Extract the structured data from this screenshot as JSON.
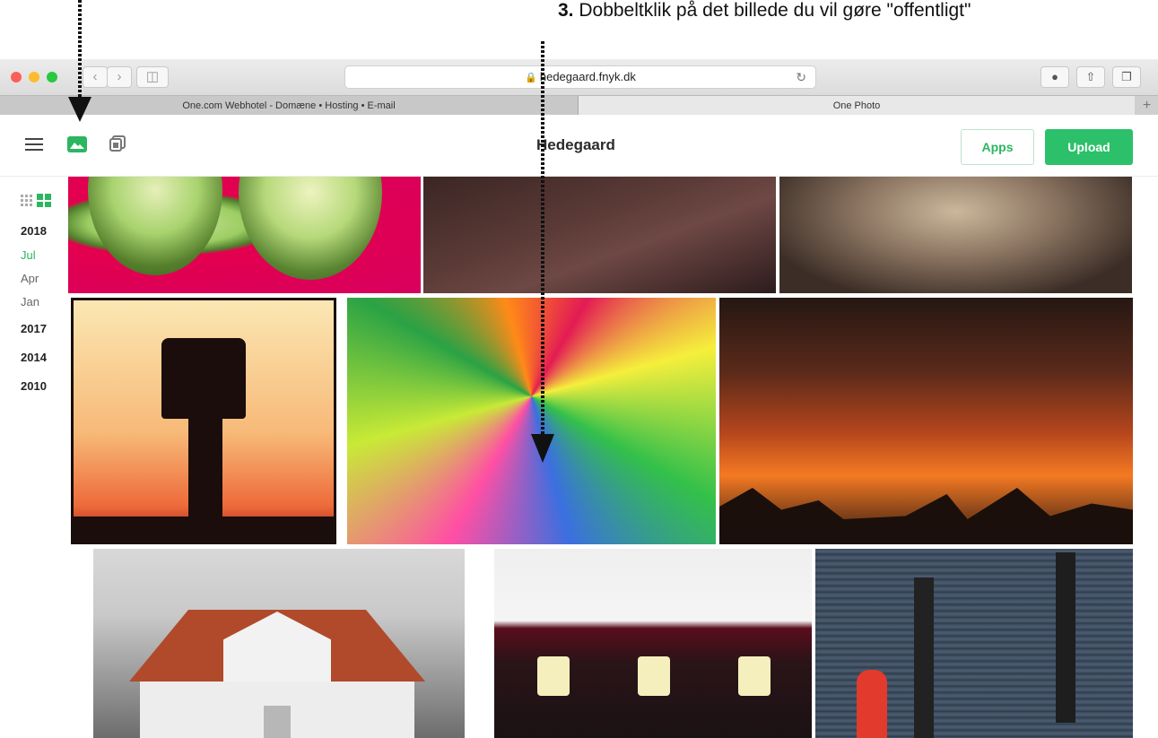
{
  "instruction": {
    "number": "3.",
    "text": " Dobbeltklik på det billede du vil gøre \"offentligt\""
  },
  "browser": {
    "url": "hedegaard.fnyk.dk",
    "tabs": [
      {
        "label": "One.com Webhotel  -  Domæne • Hosting • E-mail"
      },
      {
        "label": "One Photo"
      }
    ]
  },
  "app": {
    "title": "Hedegaard",
    "apps_label": "Apps",
    "upload_label": "Upload",
    "accent": "#2cb660"
  },
  "sidebar": {
    "timeline": [
      {
        "label": "2018",
        "type": "year"
      },
      {
        "label": "Jul",
        "type": "month",
        "active": true
      },
      {
        "label": "Apr",
        "type": "month"
      },
      {
        "label": "Jan",
        "type": "month"
      },
      {
        "label": "2017",
        "type": "year"
      },
      {
        "label": "2014",
        "type": "year"
      },
      {
        "label": "2010",
        "type": "year"
      }
    ]
  },
  "icons": {
    "menu": "hamburger-icon",
    "photos": "photos-icon",
    "albums": "albums-icon",
    "grid_small": "grid-small-icon",
    "grid_large": "grid-large-icon",
    "lock": "lock-icon",
    "reload": "reload-icon",
    "download": "download-icon",
    "share": "share-icon",
    "tabs": "tabs-icon"
  }
}
